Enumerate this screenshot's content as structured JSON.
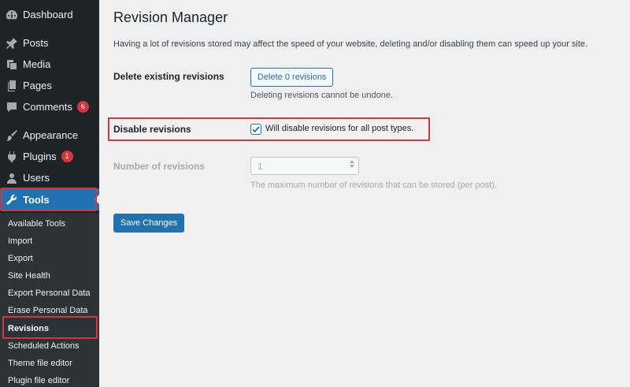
{
  "sidebar": {
    "items": [
      {
        "label": "Dashboard",
        "icon": "dashboard-icon"
      },
      {
        "label": "Posts",
        "icon": "pin-icon"
      },
      {
        "label": "Media",
        "icon": "media-icon"
      },
      {
        "label": "Pages",
        "icon": "pages-icon"
      },
      {
        "label": "Comments",
        "icon": "comment-icon",
        "badge": "6"
      },
      {
        "label": "Appearance",
        "icon": "brush-icon"
      },
      {
        "label": "Plugins",
        "icon": "plugin-icon",
        "badge": "1"
      },
      {
        "label": "Users",
        "icon": "user-icon"
      },
      {
        "label": "Tools",
        "icon": "wrench-icon"
      }
    ],
    "submenu": [
      "Available Tools",
      "Import",
      "Export",
      "Site Health",
      "Export Personal Data",
      "Erase Personal Data",
      "Revisions",
      "Scheduled Actions",
      "Theme file editor",
      "Plugin file editor"
    ]
  },
  "main": {
    "title": "Revision Manager",
    "description": "Having a lot of revisions stored may affect the speed of your website, deleting and/or disabling them can speed up your site.",
    "delete_section": {
      "label": "Delete existing revisions",
      "button_label": "Delete 0 revisions",
      "help": "Deleting revisions cannot be undone."
    },
    "disable_section": {
      "label": "Disable revisions",
      "checkbox_label": "Will disable revisions for all post types.",
      "checked": true
    },
    "number_section": {
      "label": "Number of revisions",
      "value": "1",
      "help": "The maximum number of revisions that can be stored (per post)."
    },
    "save_label": "Save Changes"
  },
  "colors": {
    "sidebar_bg": "#1d2327",
    "accent": "#2271b1",
    "highlight": "#d63638"
  }
}
